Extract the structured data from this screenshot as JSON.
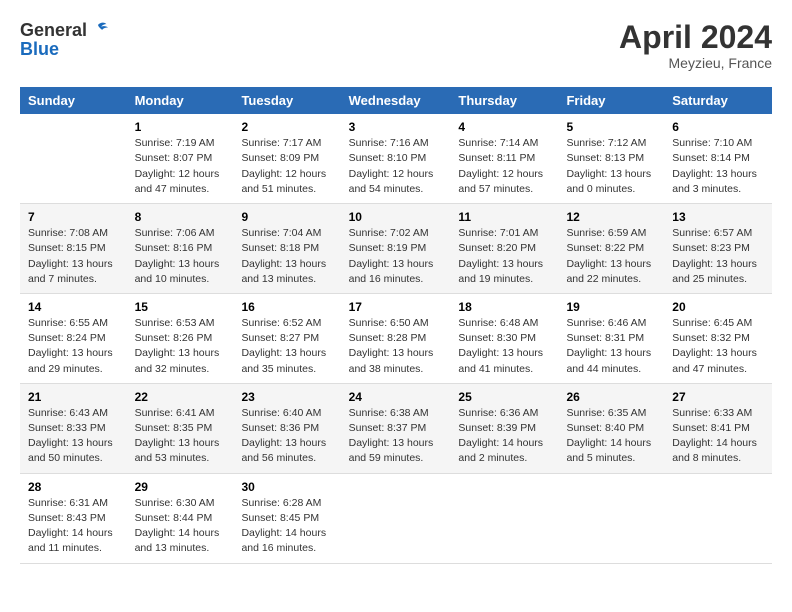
{
  "header": {
    "logo_general": "General",
    "logo_blue": "Blue",
    "month": "April 2024",
    "location": "Meyzieu, France"
  },
  "columns": [
    "Sunday",
    "Monday",
    "Tuesday",
    "Wednesday",
    "Thursday",
    "Friday",
    "Saturday"
  ],
  "weeks": [
    [
      {
        "day": "",
        "sunrise": "",
        "sunset": "",
        "daylight": ""
      },
      {
        "day": "1",
        "sunrise": "Sunrise: 7:19 AM",
        "sunset": "Sunset: 8:07 PM",
        "daylight": "Daylight: 12 hours and 47 minutes."
      },
      {
        "day": "2",
        "sunrise": "Sunrise: 7:17 AM",
        "sunset": "Sunset: 8:09 PM",
        "daylight": "Daylight: 12 hours and 51 minutes."
      },
      {
        "day": "3",
        "sunrise": "Sunrise: 7:16 AM",
        "sunset": "Sunset: 8:10 PM",
        "daylight": "Daylight: 12 hours and 54 minutes."
      },
      {
        "day": "4",
        "sunrise": "Sunrise: 7:14 AM",
        "sunset": "Sunset: 8:11 PM",
        "daylight": "Daylight: 12 hours and 57 minutes."
      },
      {
        "day": "5",
        "sunrise": "Sunrise: 7:12 AM",
        "sunset": "Sunset: 8:13 PM",
        "daylight": "Daylight: 13 hours and 0 minutes."
      },
      {
        "day": "6",
        "sunrise": "Sunrise: 7:10 AM",
        "sunset": "Sunset: 8:14 PM",
        "daylight": "Daylight: 13 hours and 3 minutes."
      }
    ],
    [
      {
        "day": "7",
        "sunrise": "Sunrise: 7:08 AM",
        "sunset": "Sunset: 8:15 PM",
        "daylight": "Daylight: 13 hours and 7 minutes."
      },
      {
        "day": "8",
        "sunrise": "Sunrise: 7:06 AM",
        "sunset": "Sunset: 8:16 PM",
        "daylight": "Daylight: 13 hours and 10 minutes."
      },
      {
        "day": "9",
        "sunrise": "Sunrise: 7:04 AM",
        "sunset": "Sunset: 8:18 PM",
        "daylight": "Daylight: 13 hours and 13 minutes."
      },
      {
        "day": "10",
        "sunrise": "Sunrise: 7:02 AM",
        "sunset": "Sunset: 8:19 PM",
        "daylight": "Daylight: 13 hours and 16 minutes."
      },
      {
        "day": "11",
        "sunrise": "Sunrise: 7:01 AM",
        "sunset": "Sunset: 8:20 PM",
        "daylight": "Daylight: 13 hours and 19 minutes."
      },
      {
        "day": "12",
        "sunrise": "Sunrise: 6:59 AM",
        "sunset": "Sunset: 8:22 PM",
        "daylight": "Daylight: 13 hours and 22 minutes."
      },
      {
        "day": "13",
        "sunrise": "Sunrise: 6:57 AM",
        "sunset": "Sunset: 8:23 PM",
        "daylight": "Daylight: 13 hours and 25 minutes."
      }
    ],
    [
      {
        "day": "14",
        "sunrise": "Sunrise: 6:55 AM",
        "sunset": "Sunset: 8:24 PM",
        "daylight": "Daylight: 13 hours and 29 minutes."
      },
      {
        "day": "15",
        "sunrise": "Sunrise: 6:53 AM",
        "sunset": "Sunset: 8:26 PM",
        "daylight": "Daylight: 13 hours and 32 minutes."
      },
      {
        "day": "16",
        "sunrise": "Sunrise: 6:52 AM",
        "sunset": "Sunset: 8:27 PM",
        "daylight": "Daylight: 13 hours and 35 minutes."
      },
      {
        "day": "17",
        "sunrise": "Sunrise: 6:50 AM",
        "sunset": "Sunset: 8:28 PM",
        "daylight": "Daylight: 13 hours and 38 minutes."
      },
      {
        "day": "18",
        "sunrise": "Sunrise: 6:48 AM",
        "sunset": "Sunset: 8:30 PM",
        "daylight": "Daylight: 13 hours and 41 minutes."
      },
      {
        "day": "19",
        "sunrise": "Sunrise: 6:46 AM",
        "sunset": "Sunset: 8:31 PM",
        "daylight": "Daylight: 13 hours and 44 minutes."
      },
      {
        "day": "20",
        "sunrise": "Sunrise: 6:45 AM",
        "sunset": "Sunset: 8:32 PM",
        "daylight": "Daylight: 13 hours and 47 minutes."
      }
    ],
    [
      {
        "day": "21",
        "sunrise": "Sunrise: 6:43 AM",
        "sunset": "Sunset: 8:33 PM",
        "daylight": "Daylight: 13 hours and 50 minutes."
      },
      {
        "day": "22",
        "sunrise": "Sunrise: 6:41 AM",
        "sunset": "Sunset: 8:35 PM",
        "daylight": "Daylight: 13 hours and 53 minutes."
      },
      {
        "day": "23",
        "sunrise": "Sunrise: 6:40 AM",
        "sunset": "Sunset: 8:36 PM",
        "daylight": "Daylight: 13 hours and 56 minutes."
      },
      {
        "day": "24",
        "sunrise": "Sunrise: 6:38 AM",
        "sunset": "Sunset: 8:37 PM",
        "daylight": "Daylight: 13 hours and 59 minutes."
      },
      {
        "day": "25",
        "sunrise": "Sunrise: 6:36 AM",
        "sunset": "Sunset: 8:39 PM",
        "daylight": "Daylight: 14 hours and 2 minutes."
      },
      {
        "day": "26",
        "sunrise": "Sunrise: 6:35 AM",
        "sunset": "Sunset: 8:40 PM",
        "daylight": "Daylight: 14 hours and 5 minutes."
      },
      {
        "day": "27",
        "sunrise": "Sunrise: 6:33 AM",
        "sunset": "Sunset: 8:41 PM",
        "daylight": "Daylight: 14 hours and 8 minutes."
      }
    ],
    [
      {
        "day": "28",
        "sunrise": "Sunrise: 6:31 AM",
        "sunset": "Sunset: 8:43 PM",
        "daylight": "Daylight: 14 hours and 11 minutes."
      },
      {
        "day": "29",
        "sunrise": "Sunrise: 6:30 AM",
        "sunset": "Sunset: 8:44 PM",
        "daylight": "Daylight: 14 hours and 13 minutes."
      },
      {
        "day": "30",
        "sunrise": "Sunrise: 6:28 AM",
        "sunset": "Sunset: 8:45 PM",
        "daylight": "Daylight: 14 hours and 16 minutes."
      },
      {
        "day": "",
        "sunrise": "",
        "sunset": "",
        "daylight": ""
      },
      {
        "day": "",
        "sunrise": "",
        "sunset": "",
        "daylight": ""
      },
      {
        "day": "",
        "sunrise": "",
        "sunset": "",
        "daylight": ""
      },
      {
        "day": "",
        "sunrise": "",
        "sunset": "",
        "daylight": ""
      }
    ]
  ]
}
